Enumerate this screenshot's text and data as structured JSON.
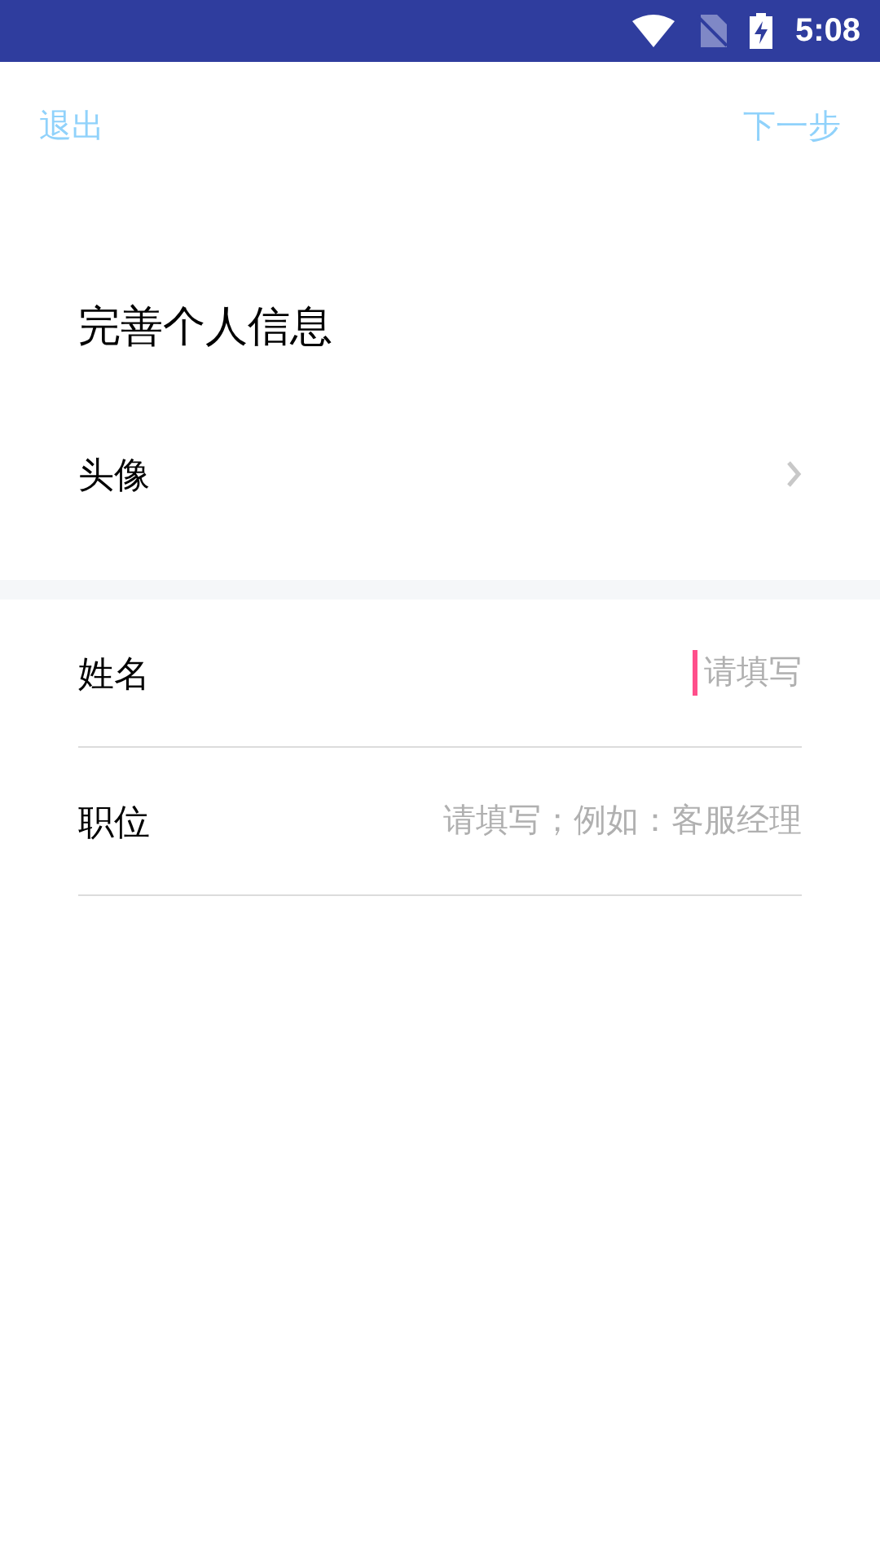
{
  "status_bar": {
    "time": "5:08"
  },
  "top_bar": {
    "exit": "退出",
    "next": "下一步"
  },
  "title": "完善个人信息",
  "avatar_row": {
    "label": "头像"
  },
  "fields": [
    {
      "label": "姓名",
      "placeholder": "请填写",
      "focused": true
    },
    {
      "label": "职位",
      "placeholder": "请填写；例如：客服经理",
      "focused": false
    }
  ]
}
